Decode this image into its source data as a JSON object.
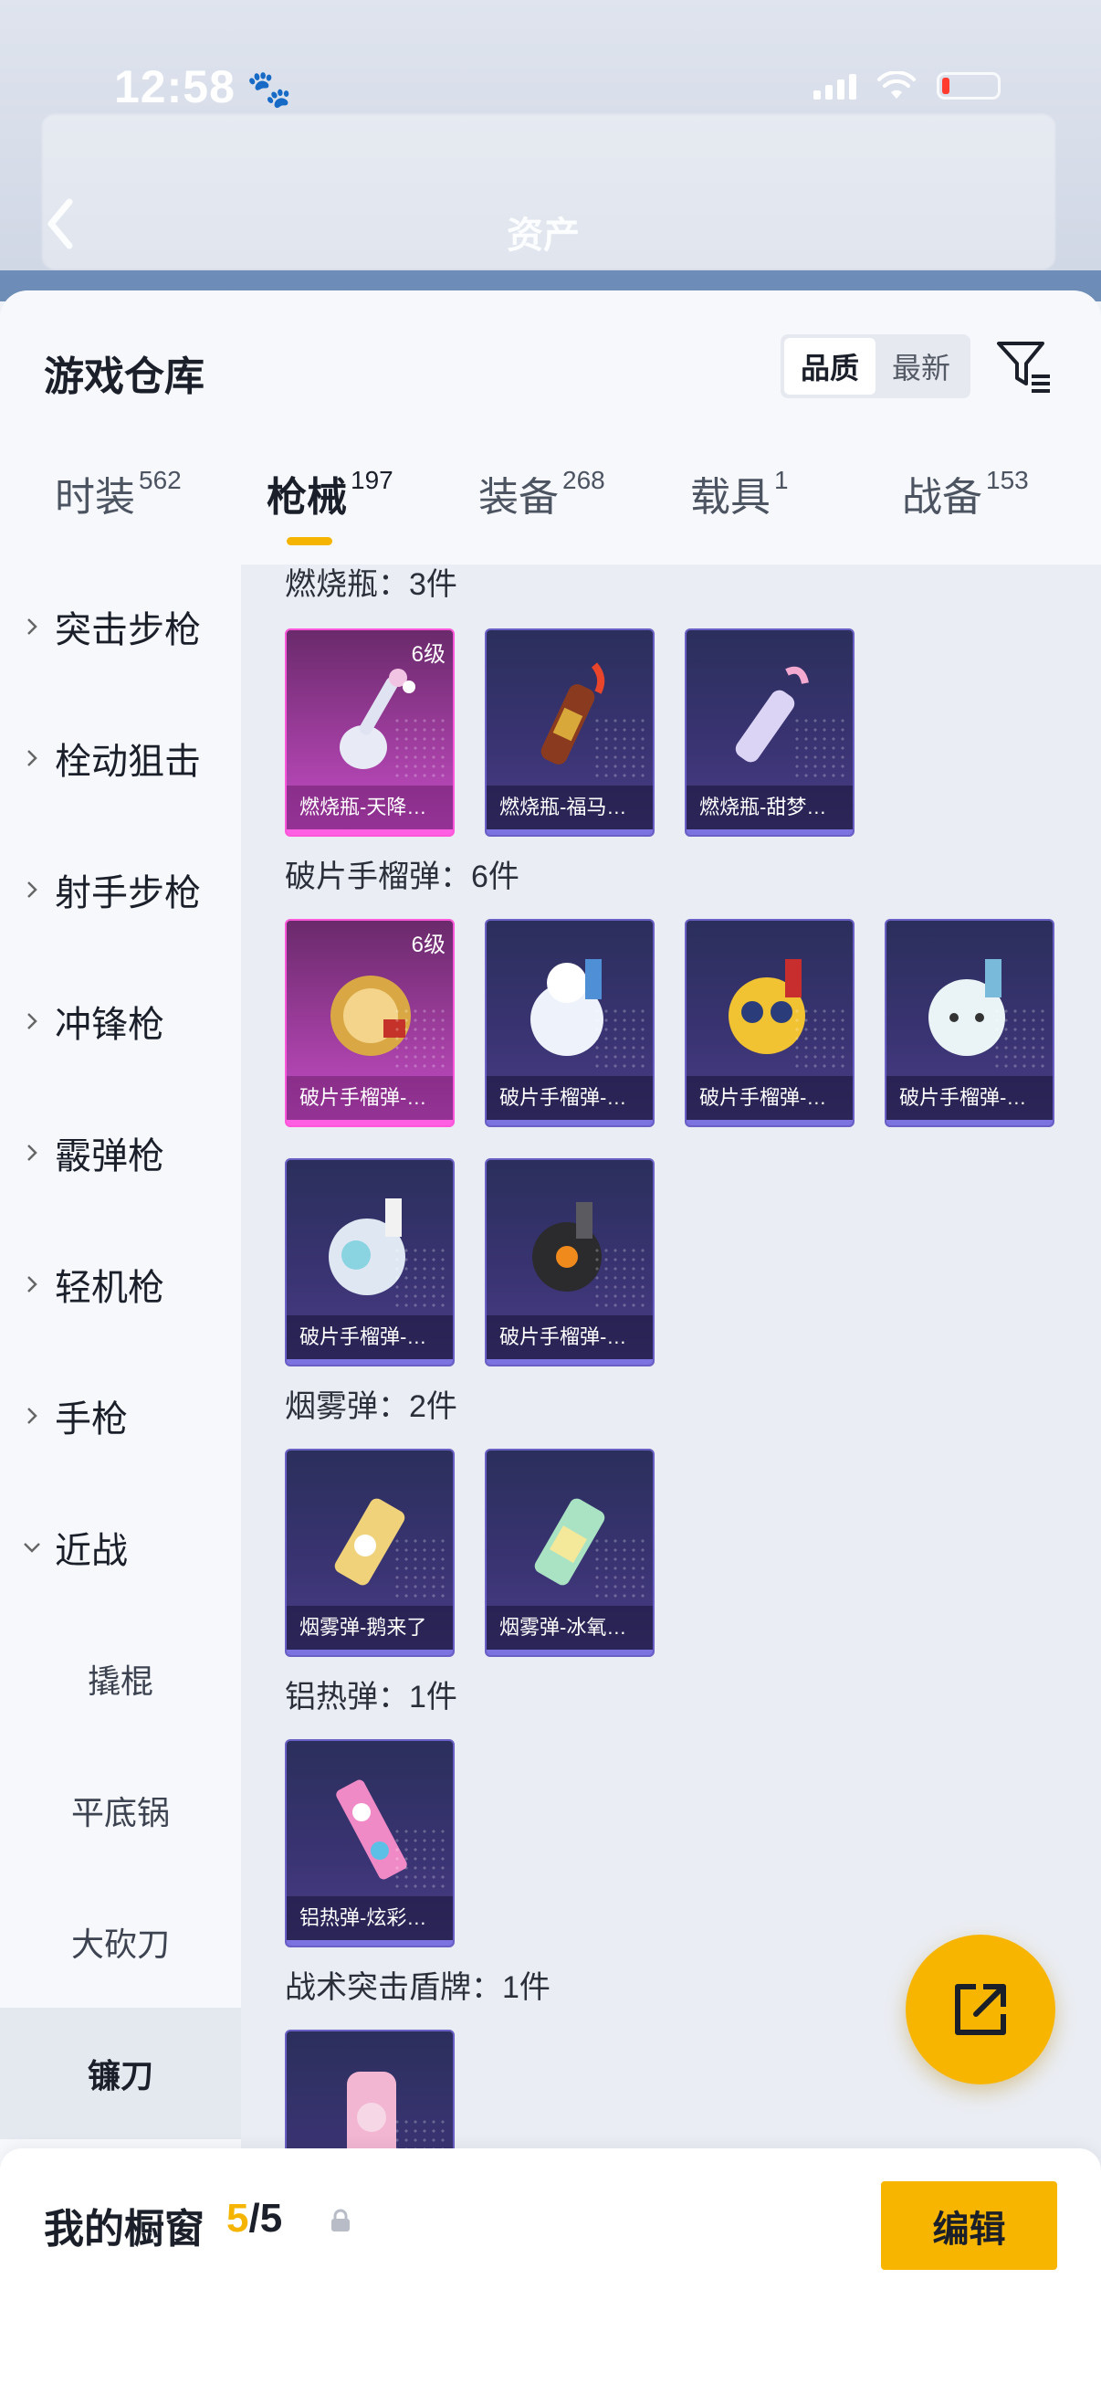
{
  "status_bar": {
    "time": "12:58"
  },
  "background_header": {
    "title": "资产"
  },
  "sheet": {
    "title": "游戏仓库",
    "sort_options": [
      "品质",
      "最新"
    ],
    "tabs": [
      {
        "label": "时装",
        "count": "562"
      },
      {
        "label": "枪械",
        "count": "197"
      },
      {
        "label": "装备",
        "count": "268"
      },
      {
        "label": "载具",
        "count": "1"
      },
      {
        "label": "战备",
        "count": "153"
      }
    ]
  },
  "sidebar": {
    "categories": [
      "突击步枪",
      "栓动狙击",
      "射手步枪",
      "冲锋枪",
      "霰弹枪",
      "轻机枪",
      "手枪",
      "近战"
    ],
    "melee_sub": [
      "撬棍",
      "平底锅",
      "大砍刀",
      "镰刀"
    ]
  },
  "content": {
    "sections": [
      {
        "title": "燃烧瓶：3件",
        "items": [
          {
            "name": "燃烧瓶-天降…",
            "level": "6级"
          },
          {
            "name": "燃烧瓶-福马…"
          },
          {
            "name": "燃烧瓶-甜梦…"
          }
        ]
      },
      {
        "title": "破片手榴弹：6件",
        "items": [
          {
            "name": "破片手榴弹-…",
            "level": "6级"
          },
          {
            "name": "破片手榴弹-…"
          },
          {
            "name": "破片手榴弹-…"
          },
          {
            "name": "破片手榴弹-…"
          },
          {
            "name": "破片手榴弹-…"
          },
          {
            "name": "破片手榴弹-…"
          }
        ]
      },
      {
        "title": "烟雾弹：2件",
        "items": [
          {
            "name": "烟雾弹-鹅来了"
          },
          {
            "name": "烟雾弹-冰氧…"
          }
        ]
      },
      {
        "title": "铝热弹：1件",
        "items": [
          {
            "name": "铝热弹-炫彩…"
          }
        ]
      },
      {
        "title": "战术突击盾牌：1件",
        "items": [
          {
            "name": ""
          }
        ]
      }
    ]
  },
  "bottom_bar": {
    "title": "我的橱窗",
    "count_current": "5",
    "count_total": "/5",
    "edit_label": "编辑"
  },
  "colors": {
    "accent": "#f7b500",
    "epic_border": "#6a5fc4",
    "legendary_border": "#ff57d9"
  }
}
